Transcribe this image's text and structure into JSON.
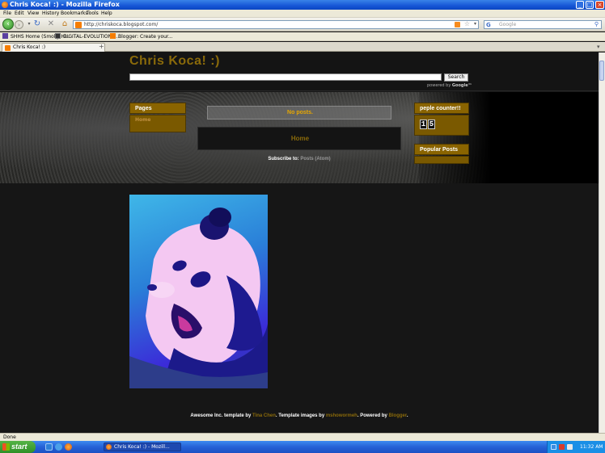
{
  "window": {
    "title": "Chris Koca! :) - Mozilla Firefox"
  },
  "menu": {
    "items": [
      "File",
      "Edit",
      "View",
      "History",
      "Bookmarks",
      "Tools",
      "Help"
    ]
  },
  "navbar": {
    "url": "http://chriskoca.blogspot.com/",
    "search_placeholder": "Google"
  },
  "bookmarks": {
    "items": [
      "SHHS Home (Smoky Hi...",
      "DIGITAL-EVOLUTIONS...",
      "Blogger: Create your..."
    ]
  },
  "tabs": {
    "items": [
      {
        "label": "Chris Koca! :)"
      }
    ],
    "new_tab": "+"
  },
  "blog": {
    "title": "Chris Koca! :)",
    "search_button": "Search",
    "powered_prefix": "powered by",
    "powered_brand": "Google™",
    "pages_header": "Pages",
    "pages_home": "Home",
    "no_posts": "No posts.",
    "home_link": "Home",
    "subscribe_label": "Subscribe to:",
    "subscribe_link": "Posts (Atom)",
    "counter_header": "peple counter!!",
    "counter_digits": [
      "1",
      "5"
    ],
    "popular_header": "Popular Posts",
    "footer": {
      "t1": "Awesome Inc. template by ",
      "l1": "Tina Chen",
      "t2": ". Template images by ",
      "l2": "mshowormeh",
      "t3": ". Powered by ",
      "l3": "Blogger",
      "t4": "."
    }
  },
  "status": {
    "text": "Done"
  },
  "taskbar": {
    "start_label": "start",
    "task_label": "Chris Koca! :) - Mozill...",
    "clock": "11:32 AM"
  },
  "colors": {
    "accent": "#8a6400",
    "link": "#8a6a0a",
    "page_bg": "#161616"
  }
}
